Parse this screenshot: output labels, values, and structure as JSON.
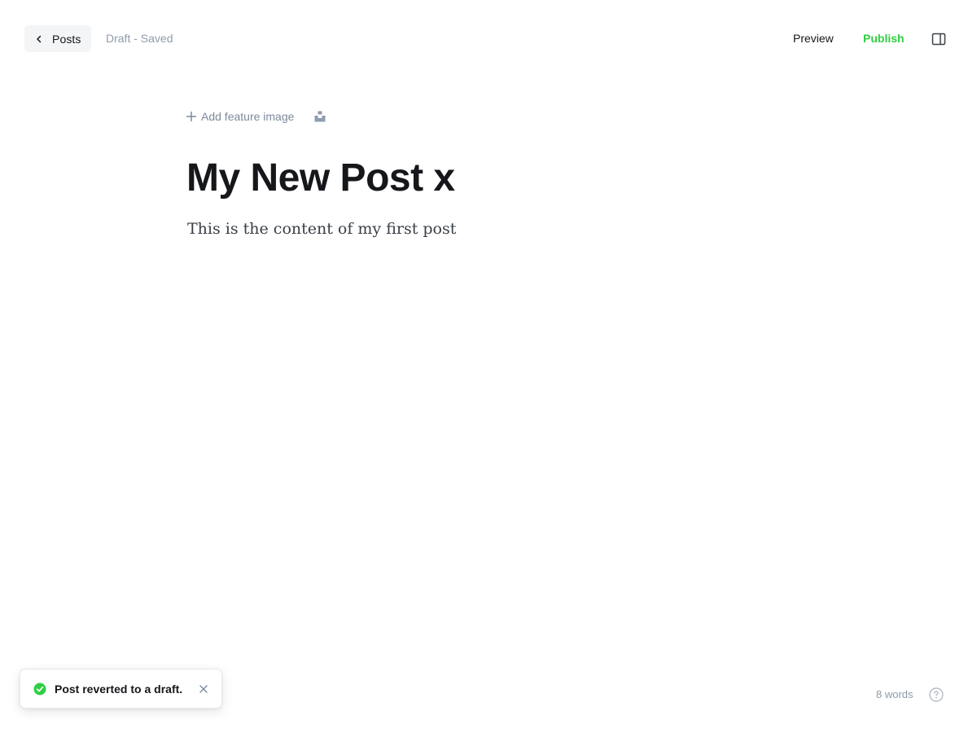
{
  "header": {
    "back_label": "Posts",
    "status": "Draft - Saved",
    "preview_label": "Preview",
    "publish_label": "Publish"
  },
  "editor": {
    "add_feature_image_label": "Add feature image",
    "title": "My New Post x",
    "body": "This is the content of my first post"
  },
  "toast": {
    "message": "Post reverted to a draft."
  },
  "footer": {
    "word_count": "8 words"
  },
  "icons": {
    "back": "chevron-left-icon",
    "sidebar": "sidebar-panel-icon",
    "add": "plus-icon",
    "unsplash": "unsplash-icon",
    "success": "check-circle-icon",
    "close": "close-icon",
    "help": "help-circle-icon"
  },
  "colors": {
    "accent_green": "#30cf43",
    "muted_text": "#8e9cac",
    "text": "#15171a"
  }
}
